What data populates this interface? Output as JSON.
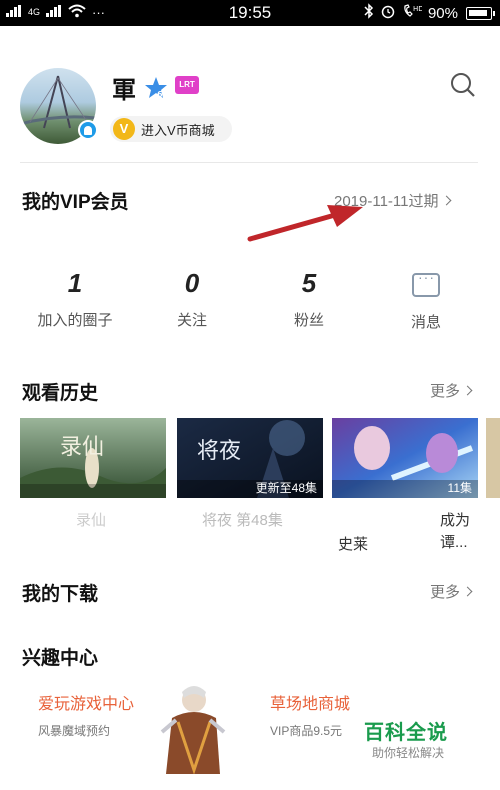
{
  "status_bar": {
    "signal_left": "4G",
    "signal_left2": "2G",
    "dots": "···",
    "time": "19:55",
    "battery": "90%"
  },
  "profile": {
    "username": "軍",
    "star_level": "6",
    "lv_badge": "LRT",
    "vstore_coin": "V",
    "vstore_label": "进入V币商城"
  },
  "vip": {
    "title": "我的VIP会员",
    "expiry": "2019-11-11过期"
  },
  "stats": [
    {
      "value": "1",
      "label": "加入的圈子"
    },
    {
      "value": "0",
      "label": "关注"
    },
    {
      "value": "5",
      "label": "粉丝"
    },
    {
      "label": "消息"
    }
  ],
  "history": {
    "title": "观看历史",
    "more": "更多",
    "items": [
      {
        "poster_text": "录仙",
        "episode": "",
        "title": "录仙"
      },
      {
        "poster_text": "将夜",
        "episode": "更新至48集",
        "title": "将夜 第48集"
      },
      {
        "poster_text": "",
        "episode": "11集",
        "title": "史莱"
      },
      {
        "poster_text": "",
        "episode": "",
        "title": "成为 谭..."
      }
    ]
  },
  "downloads": {
    "title": "我的下载",
    "more": "更多"
  },
  "interest": {
    "title": "兴趣中心",
    "items": [
      {
        "title": "爱玩游戏中心",
        "subtitle": "风暴魔域预约"
      },
      {
        "title": "草场地商城",
        "subtitle": "VIP商品9.5元"
      }
    ]
  },
  "watermark": {
    "title": "百科全说",
    "subtitle": "助你轻松解决"
  },
  "colors": {
    "accent_orange": "#e8623a",
    "vip_coin": "#f2b718",
    "badge_blue": "#1e9be8",
    "watermark_green": "#1a9b4d",
    "annotation_arrow": "#c0262a"
  }
}
